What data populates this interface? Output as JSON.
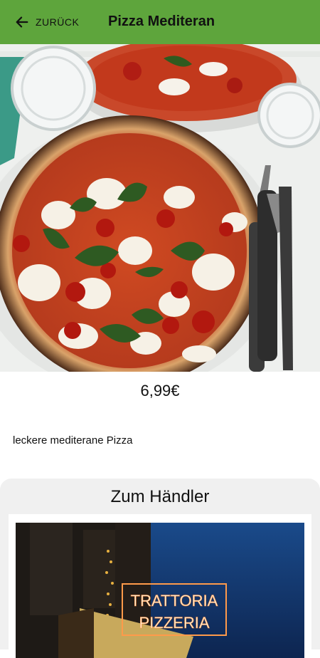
{
  "header": {
    "back_label": "ZURÜCK",
    "title": "Pizza Mediteran"
  },
  "product": {
    "price": "6,99€",
    "description": "leckere mediterane Pizza"
  },
  "merchant": {
    "heading": "Zum Händler",
    "sign_line1": "TRATTORIA",
    "sign_line2": "PIZZERIA"
  },
  "colors": {
    "header_bg": "#5ea53c",
    "card_bg": "#f0f0f0"
  },
  "icons": {
    "back": "arrow-left-icon"
  }
}
